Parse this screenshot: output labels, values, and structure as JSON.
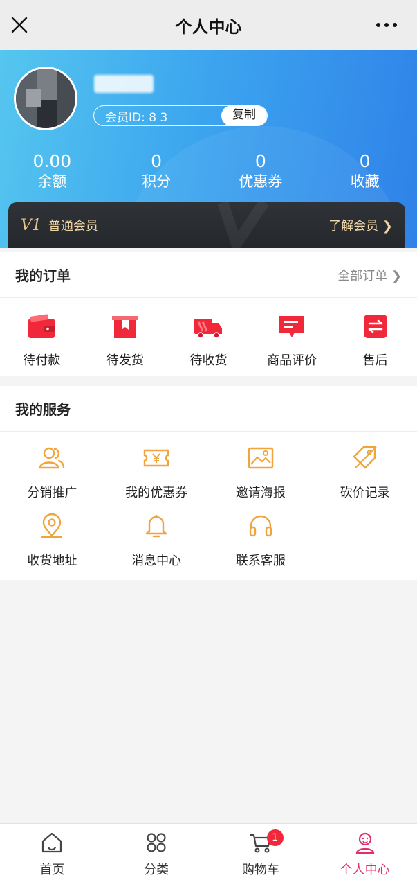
{
  "topbar": {
    "title": "个人中心",
    "close_icon": "close-icon",
    "more_icon": "more-icon"
  },
  "profile": {
    "member_id_label": "会员ID: 8          3",
    "copy_label": "复制"
  },
  "stats": [
    {
      "value": "0.00",
      "label": "余额"
    },
    {
      "value": "0",
      "label": "积分"
    },
    {
      "value": "0",
      "label": "优惠券"
    },
    {
      "value": "0",
      "label": "收藏"
    }
  ],
  "vip": {
    "badge": "V1",
    "level": "普通会员",
    "learn": "了解会员 ❯"
  },
  "orders": {
    "title": "我的订单",
    "all_label": "全部订单 ❯",
    "items": [
      {
        "label": "待付款",
        "icon": "wallet-icon"
      },
      {
        "label": "待发货",
        "icon": "package-icon"
      },
      {
        "label": "待收货",
        "icon": "truck-icon"
      },
      {
        "label": "商品评价",
        "icon": "comment-icon"
      },
      {
        "label": "售后",
        "icon": "exchange-icon"
      }
    ]
  },
  "services": {
    "title": "我的服务",
    "items": [
      {
        "label": "分销推广",
        "icon": "users-icon"
      },
      {
        "label": "我的优惠券",
        "icon": "coupon-icon"
      },
      {
        "label": "邀请海报",
        "icon": "image-icon"
      },
      {
        "label": "砍价记录",
        "icon": "tag-icon"
      },
      {
        "label": "收货地址",
        "icon": "location-icon"
      },
      {
        "label": "消息中心",
        "icon": "bell-icon"
      },
      {
        "label": "联系客服",
        "icon": "headset-icon"
      }
    ]
  },
  "tabbar": {
    "items": [
      {
        "label": "首页",
        "icon": "home-icon"
      },
      {
        "label": "分类",
        "icon": "grid-icon"
      },
      {
        "label": "购物车",
        "icon": "cart-icon",
        "badge": "1"
      },
      {
        "label": "个人中心",
        "icon": "user-icon"
      }
    ],
    "active_color": "#e0306b"
  },
  "colors": {
    "accent_red": "#f0283a",
    "service_orange": "#f0a43a",
    "header_blue": "#3da6ef"
  }
}
